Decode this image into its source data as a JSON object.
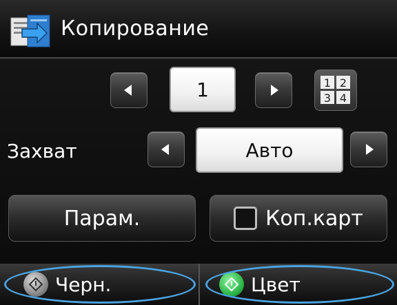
{
  "header": {
    "title": "Копирование",
    "icon": "copy-icon"
  },
  "copies": {
    "value": "1"
  },
  "capture": {
    "label": "Захват",
    "value": "Авто"
  },
  "buttons": {
    "params_label": "Парам.",
    "idcard_label": "Коп.карт"
  },
  "footer": {
    "black_label": "Черн.",
    "color_label": "Цвет"
  },
  "colors": {
    "accent": "#4aa3e0",
    "start_green": "#2eb84a",
    "start_gray": "#8a8a8a"
  }
}
